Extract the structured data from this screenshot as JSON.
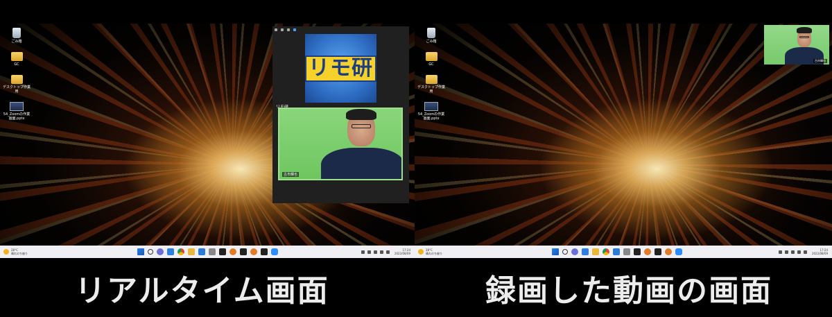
{
  "left_panel": {
    "desktop_icons": [
      {
        "label": "ごみ箱",
        "icon": "recycle-bin-icon"
      },
      {
        "label": "GC",
        "icon": "folder-icon"
      },
      {
        "label": "デスクトップ作業用",
        "icon": "folder-icon"
      },
      {
        "label": "54_Zoomの作業画面.pptx",
        "icon": "pptx-file-icon"
      }
    ],
    "zoom_window": {
      "logo_text": "リモ研",
      "participant_1_name": "リモ研",
      "participant_2_name": "古市輝也"
    },
    "taskbar": {
      "weather_temp": "28°C",
      "weather_desc": "晴れのち曇り",
      "time": "17:24",
      "date": "2022/08/09"
    },
    "caption": "リアルタイム画面"
  },
  "right_panel": {
    "desktop_icons": [
      {
        "label": "ごみ箱",
        "icon": "recycle-bin-icon"
      },
      {
        "label": "GC",
        "icon": "folder-icon"
      },
      {
        "label": "デスクトップ作業用",
        "icon": "folder-icon"
      },
      {
        "label": "54_Zoomの作業画面.pptx",
        "icon": "pptx-file-icon"
      }
    ],
    "recorded_video": {
      "participant_name": "古市輝也"
    },
    "taskbar": {
      "weather_temp": "28°C",
      "weather_desc": "晴れのち曇り",
      "time": "17:24",
      "date": "2022/08/09"
    },
    "caption": "録画した動画の画面"
  }
}
